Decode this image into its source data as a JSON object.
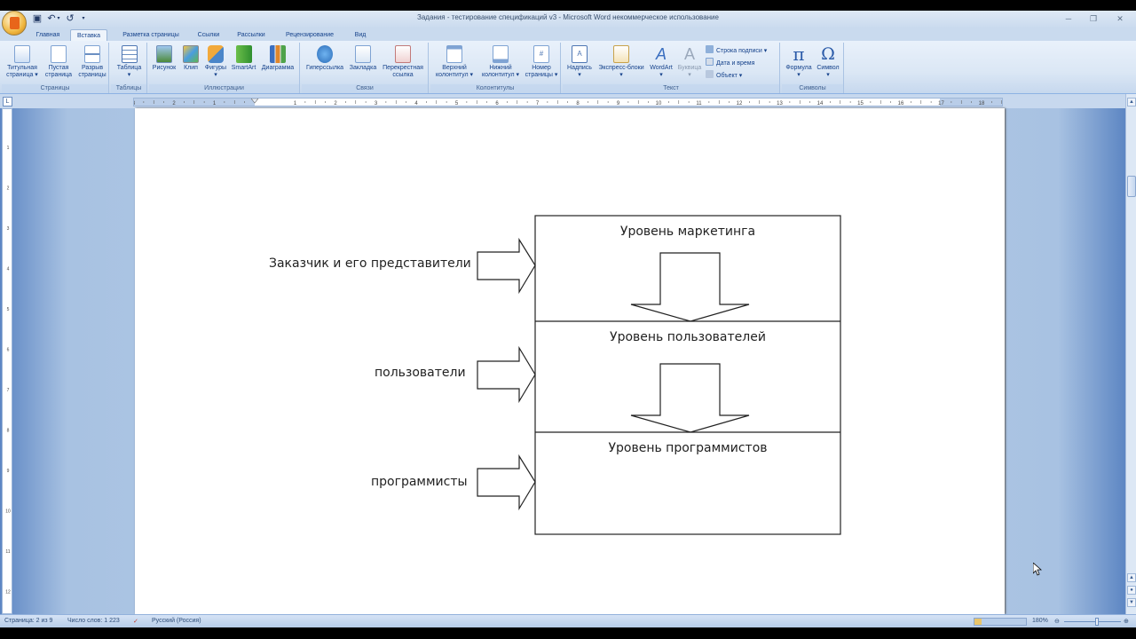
{
  "window": {
    "title": "Задания - тестирование спецификаций v3 - Microsoft Word некоммерческое использование"
  },
  "tabs": [
    "Главная",
    "Вставка",
    "Разметка страницы",
    "Ссылки",
    "Рассылки",
    "Рецензирование",
    "Вид"
  ],
  "ribbon": {
    "groups": {
      "pages": "Страницы",
      "tables": "Таблицы",
      "illustrations": "Иллюстрации",
      "links": "Связи",
      "headers": "Колонтитулы",
      "text": "Текст",
      "symbols": "Символы"
    },
    "buttons": {
      "cover_page": "Титульная\nстраница ▾",
      "blank_page": "Пустая\nстраница",
      "page_break": "Разрыв\nстраницы",
      "table": "Таблица\n▾",
      "picture": "Рисунок",
      "clip": "Клип",
      "shapes": "Фигуры\n▾",
      "smartart": "SmartArt",
      "chart": "Диаграмма",
      "hyperlink": "Гиперссылка",
      "bookmark": "Закладка",
      "cross_reference": "Перекрестная\nссылка",
      "header": "Верхний\nколонтитул ▾",
      "footer": "Нижний\nколонтитул ▾",
      "page_number": "Номер\nстраницы ▾",
      "text_box": "Надпись\n▾",
      "quick_parts": "Экспресс-блоки\n▾",
      "wordart": "WordArt\n▾",
      "drop_cap": "Буквица\n▾",
      "signature_line": "Строка подписи ▾",
      "date_time": "Дата и время",
      "object": "Объект ▾",
      "equation": "Формула\n▾",
      "symbol": "Символ\n▾"
    }
  },
  "ruler": {
    "numbers": [
      "3",
      "2",
      "1",
      "1",
      "2",
      "3",
      "4",
      "5",
      "6",
      "7",
      "8",
      "9",
      "10",
      "11",
      "12",
      "13",
      "14",
      "15",
      "16",
      "17",
      "18"
    ],
    "vnumbers": [
      "1",
      "2",
      "3",
      "4",
      "5",
      "6",
      "7",
      "8",
      "9",
      "10",
      "11",
      "12"
    ]
  },
  "diagram": {
    "left_labels": [
      "Заказчик и его представители",
      "пользователи",
      "программисты"
    ],
    "levels": [
      "Уровень маркетинга",
      "Уровень пользователей",
      "Уровень программистов"
    ]
  },
  "statusbar": {
    "page": "Страница: 2 из 9",
    "words": "Число слов: 1 223",
    "language": "Русский (Россия)",
    "zoom": "180%"
  }
}
